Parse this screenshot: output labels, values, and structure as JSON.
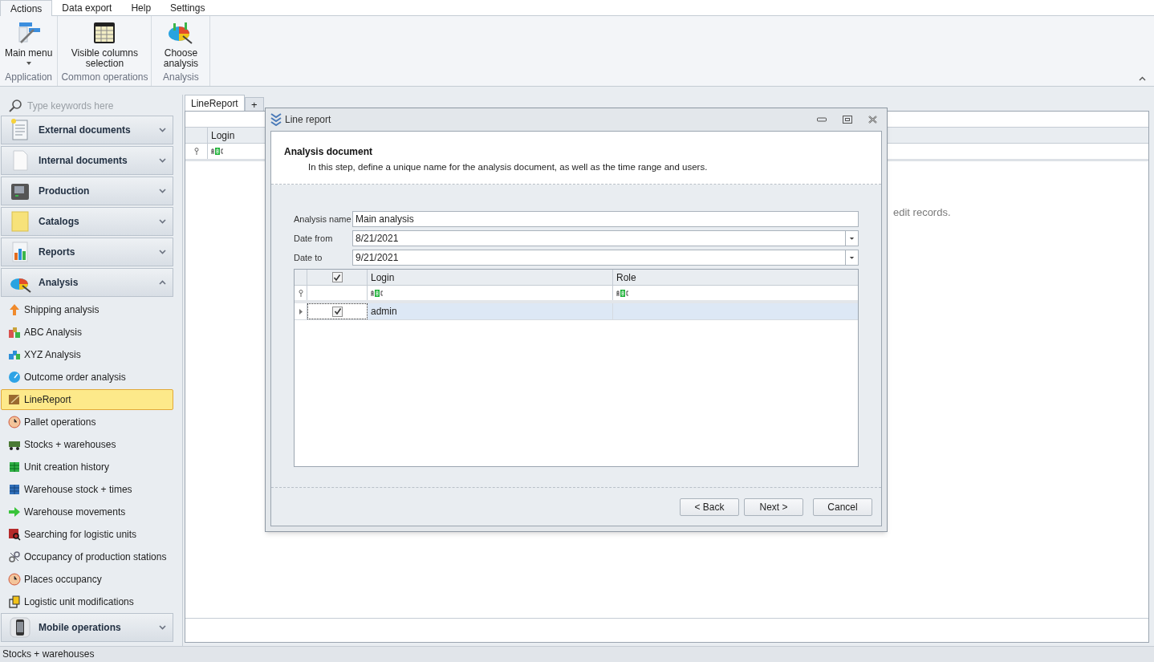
{
  "ribbon": {
    "tabs": [
      {
        "label": "Actions",
        "selected": true
      },
      {
        "label": "Data export",
        "selected": false
      },
      {
        "label": "Help",
        "selected": false
      },
      {
        "label": "Settings",
        "selected": false
      }
    ],
    "groups": [
      {
        "label": "Application",
        "buttons": [
          {
            "label": "Main menu",
            "dropdown": true,
            "kind": "menu"
          }
        ]
      },
      {
        "label": "Common operations",
        "buttons": [
          {
            "label": "Visible columns selection",
            "dropdown": false,
            "kind": "columns"
          }
        ]
      },
      {
        "label": "Analysis",
        "buttons": [
          {
            "label": "Choose analysis",
            "dropdown": false,
            "kind": "analysis"
          }
        ]
      }
    ]
  },
  "sidebar": {
    "search": {
      "placeholder": "Type keywords here"
    },
    "groups": [
      {
        "label": "External documents",
        "expanded": false,
        "kind": "external"
      },
      {
        "label": "Internal documents",
        "expanded": false,
        "kind": "internal"
      },
      {
        "label": "Production",
        "expanded": false,
        "kind": "production"
      },
      {
        "label": "Catalogs",
        "expanded": false,
        "kind": "catalogs"
      },
      {
        "label": "Reports",
        "expanded": false,
        "kind": "reports"
      },
      {
        "label": "Analysis",
        "expanded": true,
        "kind": "analysis",
        "items": [
          {
            "label": "Shipping analysis",
            "selected": false
          },
          {
            "label": "ABC Analysis",
            "selected": false
          },
          {
            "label": "XYZ Analysis",
            "selected": false
          },
          {
            "label": "Outcome order analysis",
            "selected": false
          },
          {
            "label": "LineReport",
            "selected": true
          },
          {
            "label": "Pallet operations",
            "selected": false
          },
          {
            "label": "Stocks + warehouses",
            "selected": false
          },
          {
            "label": "Unit creation history",
            "selected": false
          },
          {
            "label": "Warehouse stock + times",
            "selected": false
          },
          {
            "label": "Warehouse movements",
            "selected": false
          },
          {
            "label": "Searching for logistic units",
            "selected": false
          },
          {
            "label": "Occupancy of production stations",
            "selected": false
          },
          {
            "label": "Places occupancy",
            "selected": false
          },
          {
            "label": "Logistic unit modifications",
            "selected": false
          }
        ]
      },
      {
        "label": "Mobile operations",
        "expanded": false,
        "kind": "mobile"
      }
    ]
  },
  "document_tabs": {
    "tabs": [
      {
        "label": "LineReport",
        "selected": true
      }
    ],
    "add_glyph": "+"
  },
  "grid": {
    "columns": [
      "Login"
    ],
    "hint": "edit records."
  },
  "dialog": {
    "title": "Line report",
    "heading": "Analysis document",
    "description": "In this step, define a unique name for the analysis document, as well as the time range and users.",
    "fields": [
      {
        "label": "Analysis name",
        "value": "Main analysis",
        "kind": "text"
      },
      {
        "label": "Date from",
        "value": "8/21/2021",
        "kind": "date"
      },
      {
        "label": "Date to",
        "value": "9/21/2021",
        "kind": "date"
      }
    ],
    "users": {
      "all_checked": true,
      "columns": [
        "Login",
        "Role"
      ],
      "rows": [
        {
          "checked": true,
          "login": "admin",
          "selected": true
        }
      ]
    },
    "buttons": [
      "< Back",
      "Next >",
      "Cancel"
    ]
  },
  "status_bar": "Stocks + warehouses"
}
